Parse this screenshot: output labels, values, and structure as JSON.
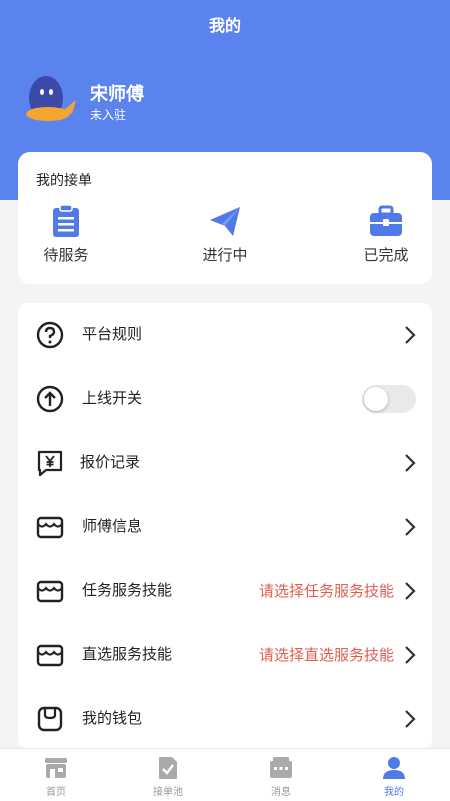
{
  "header": {
    "title": "我的"
  },
  "profile": {
    "name": "宋师傅",
    "status": "未入驻"
  },
  "orders": {
    "title": "我的接单",
    "items": [
      {
        "label": "待服务",
        "icon": "clipboard-icon"
      },
      {
        "label": "进行中",
        "icon": "paper-plane-icon"
      },
      {
        "label": "已完成",
        "icon": "briefcase-icon"
      }
    ]
  },
  "menu": {
    "rules": {
      "label": "平台规则",
      "icon": "question-circle-icon"
    },
    "online": {
      "label": "上线开关",
      "icon": "arrow-up-circle-icon",
      "on": false
    },
    "quote": {
      "label": "报价记录",
      "icon": "yen-chat-icon"
    },
    "master_info": {
      "label": "师傅信息",
      "icon": "store-icon"
    },
    "task_skill": {
      "label": "任务服务技能",
      "hint": "请选择任务服务技能",
      "icon": "store-icon"
    },
    "direct_skill": {
      "label": "直选服务技能",
      "hint": "请选择直选服务技能",
      "icon": "store-icon"
    },
    "wallet": {
      "label": "我的钱包",
      "icon": "wallet-icon"
    }
  },
  "tabbar": {
    "items": [
      {
        "label": "首页",
        "icon": "shop-icon"
      },
      {
        "label": "接单池",
        "icon": "document-check-icon"
      },
      {
        "label": "消息",
        "icon": "message-icon"
      },
      {
        "label": "我的",
        "icon": "person-icon",
        "active": true
      }
    ]
  },
  "colors": {
    "primary": "#5b83ee",
    "hint": "#e45b4f",
    "tab_active": "#4f7ae8"
  }
}
